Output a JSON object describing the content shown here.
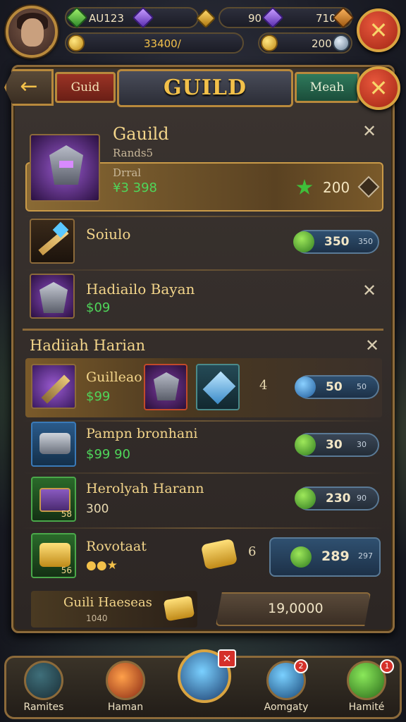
{
  "resources": {
    "gold_top": "AU123",
    "gems_top": "90",
    "crystals_top": "710",
    "coins_main": "33400/",
    "coins_right": "200"
  },
  "header": {
    "back_icon": "back-arrow-icon",
    "left_tab": "Guid",
    "title": "GUILD",
    "right_tab": "Meah"
  },
  "guild_card": {
    "name": "Gauild",
    "subtitle": "Rands5",
    "detail_label": "Drral",
    "detail_value": "¥3 398",
    "price": "200",
    "price_icon": "emerald-icon"
  },
  "items": [
    {
      "name": "Soiulo",
      "price": "350",
      "price_small": "350"
    },
    {
      "name": "Hadiailo Bayan",
      "value": "$09"
    }
  ],
  "rewards_section": {
    "title": "Hadiiah Harian",
    "rows": [
      {
        "name": "Guilleao",
        "value": "$99",
        "mid_count": "4",
        "price": "50",
        "price_small": "50"
      },
      {
        "name": "Pampn bronhani",
        "value": "$99 90",
        "price": "30",
        "price_small": "30"
      },
      {
        "name": "Herolyah Harann",
        "value": "300",
        "icon_count": "58",
        "price": "230",
        "price_small": "90"
      },
      {
        "name": "Rovotaat",
        "icon_count": "56",
        "mid_count": "6",
        "price": "289",
        "price_small": "297"
      }
    ],
    "guild_bar": {
      "label": "Guili Haeseas",
      "sub": "1040",
      "total": "19,0000"
    }
  },
  "bottom_nav": [
    {
      "label": "Ramites",
      "icon": "home-icon"
    },
    {
      "label": "Haman",
      "icon": "fire-icon"
    },
    {
      "label": "",
      "icon": "battle-icon"
    },
    {
      "label": "Aomgaty",
      "icon": "crystal-icon",
      "badge": "2"
    },
    {
      "label": "Hamité",
      "icon": "settings-icon",
      "badge": "1"
    }
  ],
  "colors": {
    "accent_gold": "#f3c14a",
    "frame": "#8c6a3a",
    "price_green": "#4fd65a",
    "close_red": "#c8321c"
  }
}
